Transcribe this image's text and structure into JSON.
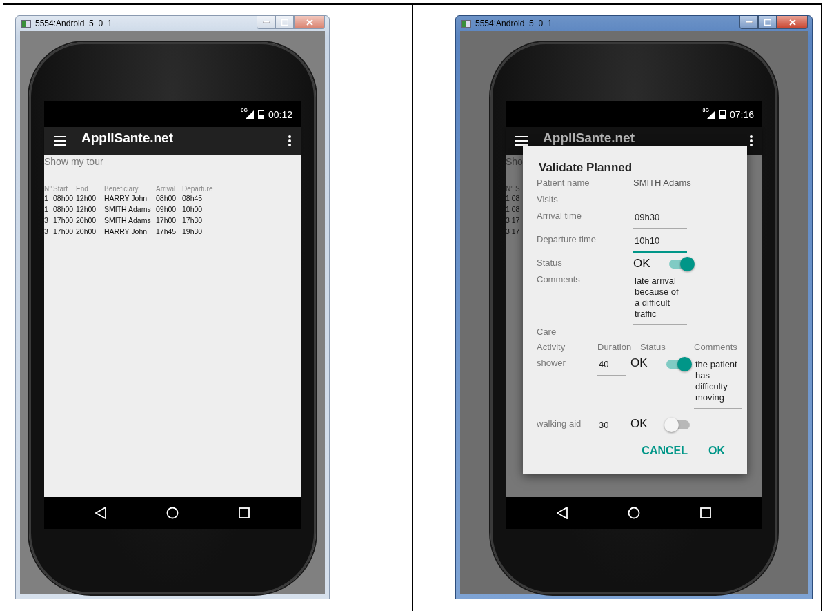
{
  "windows": [
    {
      "title": "5554:Android_5_0_1",
      "active": false,
      "screen": {
        "network": "3G",
        "time": "00:12",
        "app_title": "AppliSante.net",
        "dimmed": false,
        "heading": "Show my tour",
        "columns": [
          "N°",
          "Start",
          "End",
          "Beneficiary",
          "Arrival",
          "Departure"
        ],
        "rows": [
          [
            "1",
            "08h00",
            "12h00",
            "HARRY John",
            "08h00",
            "08h45"
          ],
          [
            "1",
            "08h00",
            "12h00",
            "SMITH Adams",
            "09h00",
            "10h00"
          ],
          [
            "3",
            "17h00",
            "20h00",
            "SMITH Adams",
            "17h00",
            "17h30"
          ],
          [
            "3",
            "17h00",
            "20h00",
            "HARRY John",
            "17h45",
            "19h30"
          ]
        ]
      }
    },
    {
      "title": "5554:Android_5_0_1",
      "active": true,
      "screen": {
        "network": "3G",
        "time": "07:16",
        "app_title": "AppliSante.net",
        "dimmed": true,
        "heading": "Sho",
        "columns": [
          "N° S"
        ],
        "rows": [
          [
            "1 08"
          ],
          [
            "1 08"
          ],
          [
            "3 17"
          ],
          [
            "3 17"
          ]
        ],
        "dialog": {
          "title": "Validate Planned",
          "fields": [
            {
              "kind": "text",
              "label": "Patient name",
              "value": "SMITH Adams"
            },
            {
              "kind": "heading",
              "label": "Visits"
            },
            {
              "kind": "input",
              "label": "Arrival time",
              "value": "09h30",
              "focused": false
            },
            {
              "kind": "input",
              "label": "Departure time",
              "value": "10h10",
              "focused": true
            },
            {
              "kind": "switch",
              "label": "Status",
              "value": "OK",
              "on": true
            },
            {
              "kind": "input",
              "label": "Comments",
              "value": "late arrival because of a difficult traffic",
              "focused": false
            },
            {
              "kind": "heading",
              "label": "Care"
            }
          ],
          "care_columns": [
            "Activity",
            "Duration",
            "Status",
            "Comments"
          ],
          "care_rows": [
            {
              "activity": "shower",
              "duration": "40",
              "status": "OK",
              "on": true,
              "comments": "the patient has difficulty moving"
            },
            {
              "activity": "walking aid",
              "duration": "30",
              "status": "OK",
              "on": false
            }
          ],
          "buttons": [
            "CANCEL",
            "OK"
          ]
        }
      }
    }
  ]
}
